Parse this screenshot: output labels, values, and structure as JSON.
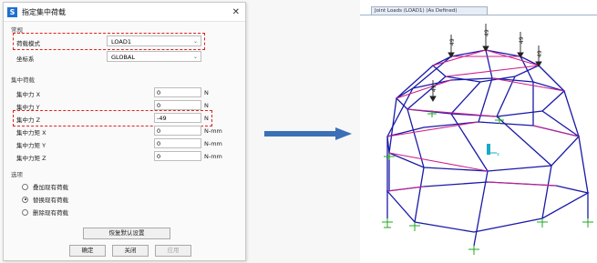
{
  "dialog": {
    "title": "指定集中荷载",
    "app_icon": "S",
    "section_general": "常规",
    "load_pattern_label": "荷载模式",
    "load_pattern_value": "LOAD1",
    "coord_label": "坐标系",
    "coord_value": "GLOBAL",
    "section_loads": "集中荷载",
    "rows": [
      {
        "label": "集中力 X",
        "value": "0",
        "unit": "N"
      },
      {
        "label": "集中力 Y",
        "value": "0",
        "unit": "N"
      },
      {
        "label": "集中力 Z",
        "value": "-49",
        "unit": "N"
      },
      {
        "label": "集中力矩 X",
        "value": "0",
        "unit": "N-mm"
      },
      {
        "label": "集中力矩 Y",
        "value": "0",
        "unit": "N-mm"
      },
      {
        "label": "集中力矩 Z",
        "value": "0",
        "unit": "N-mm"
      }
    ],
    "section_options": "选项",
    "options": [
      "叠加现有荷载",
      "替换现有荷载",
      "删除现有荷载"
    ],
    "selected_option": 1,
    "reset_button": "恢复默认设置",
    "ok_button": "确定",
    "close_button": "关闭",
    "apply_button": "应用"
  },
  "viewer": {
    "tab_label": "Joint Loads (LOAD1) (As Defined)",
    "load_labels": [
      "49",
      "49",
      "49",
      "49",
      "49"
    ]
  },
  "colors": {
    "highlight": "#e02020",
    "frame_blue": "#1a1aa8",
    "frame_magenta": "#d01f8f",
    "arrow_blue": "#3b6fb6",
    "support_green": "#1faa1f"
  }
}
